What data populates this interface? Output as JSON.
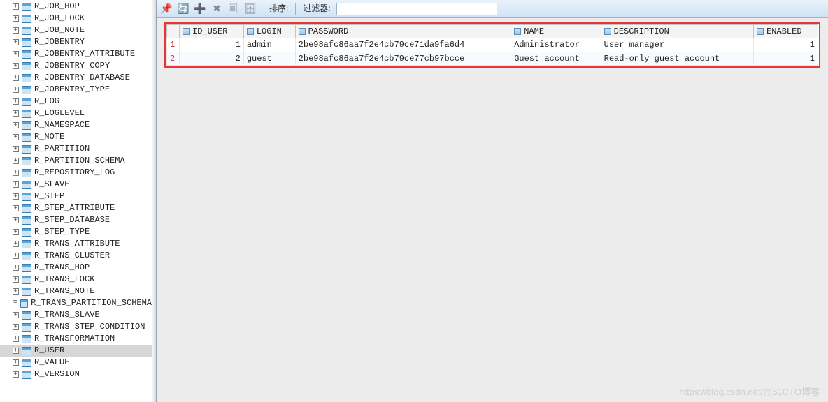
{
  "tree": {
    "items": [
      "R_JOB_HOP",
      "R_JOB_LOCK",
      "R_JOB_NOTE",
      "R_JOBENTRY",
      "R_JOBENTRY_ATTRIBUTE",
      "R_JOBENTRY_COPY",
      "R_JOBENTRY_DATABASE",
      "R_JOBENTRY_TYPE",
      "R_LOG",
      "R_LOGLEVEL",
      "R_NAMESPACE",
      "R_NOTE",
      "R_PARTITION",
      "R_PARTITION_SCHEMA",
      "R_REPOSITORY_LOG",
      "R_SLAVE",
      "R_STEP",
      "R_STEP_ATTRIBUTE",
      "R_STEP_DATABASE",
      "R_STEP_TYPE",
      "R_TRANS_ATTRIBUTE",
      "R_TRANS_CLUSTER",
      "R_TRANS_HOP",
      "R_TRANS_LOCK",
      "R_TRANS_NOTE",
      "R_TRANS_PARTITION_SCHEMA",
      "R_TRANS_SLAVE",
      "R_TRANS_STEP_CONDITION",
      "R_TRANSFORMATION",
      "R_USER",
      "R_VALUE",
      "R_VERSION"
    ],
    "selected": "R_USER"
  },
  "toolbar": {
    "sort_label": "排序:",
    "filter_label": "过滤器:",
    "filter_value": ""
  },
  "grid": {
    "columns": [
      "ID_USER",
      "LOGIN",
      "PASSWORD",
      "NAME",
      "DESCRIPTION",
      "ENABLED"
    ],
    "rows": [
      {
        "rownum": "1",
        "ID_USER": "1",
        "LOGIN": "admin",
        "PASSWORD": "2be98afc86aa7f2e4cb79ce71da9fa6d4",
        "NAME": "Administrator",
        "DESCRIPTION": "User manager",
        "ENABLED": "1"
      },
      {
        "rownum": "2",
        "ID_USER": "2",
        "LOGIN": "guest",
        "PASSWORD": "2be98afc86aa7f2e4cb79ce77cb97bcce",
        "NAME": "Guest account",
        "DESCRIPTION": "Read-only guest account",
        "ENABLED": "1"
      }
    ]
  },
  "watermark": "https://blog.csdn.net/@51CTO博客"
}
